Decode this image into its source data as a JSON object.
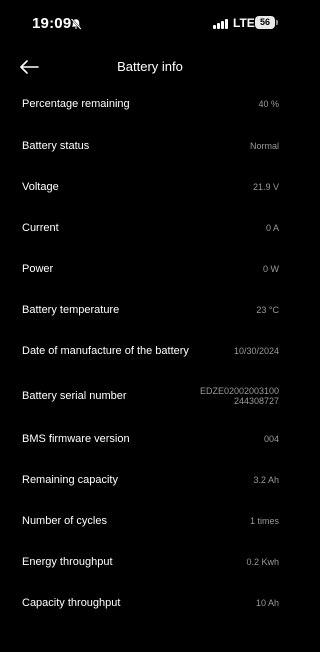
{
  "status_bar": {
    "time": "19:09",
    "network": "LTE",
    "battery_level": "56",
    "icons": [
      "bell-off-icon",
      "signal-icon",
      "battery-icon"
    ]
  },
  "header": {
    "title": "Battery info",
    "back_icon": "arrow-left-icon"
  },
  "rows": [
    {
      "label": "Percentage remaining",
      "value": "40 %"
    },
    {
      "label": "Battery status",
      "value": "Normal"
    },
    {
      "label": "Voltage",
      "value": "21.9 V"
    },
    {
      "label": "Current",
      "value": "0 A"
    },
    {
      "label": "Power",
      "value": "0 W"
    },
    {
      "label": "Battery temperature",
      "value": "23 °C"
    },
    {
      "label": "Date of manufacture of the battery",
      "value": "10/30/2024"
    },
    {
      "label": "Battery serial number",
      "value_line1": "EDZE02002003100",
      "value_line2": "244308727"
    },
    {
      "label": "BMS firmware version",
      "value": "004"
    },
    {
      "label": "Remaining capacity",
      "value": "3.2 Ah"
    },
    {
      "label": "Number of cycles",
      "value": "1 times"
    },
    {
      "label": "Energy throughput",
      "value": "0.2 Kwh"
    },
    {
      "label": "Capacity throughput",
      "value": "10 Ah"
    }
  ],
  "colors": {
    "background": "#000000",
    "label": "#ffffff",
    "value": "#9a9a9a"
  }
}
